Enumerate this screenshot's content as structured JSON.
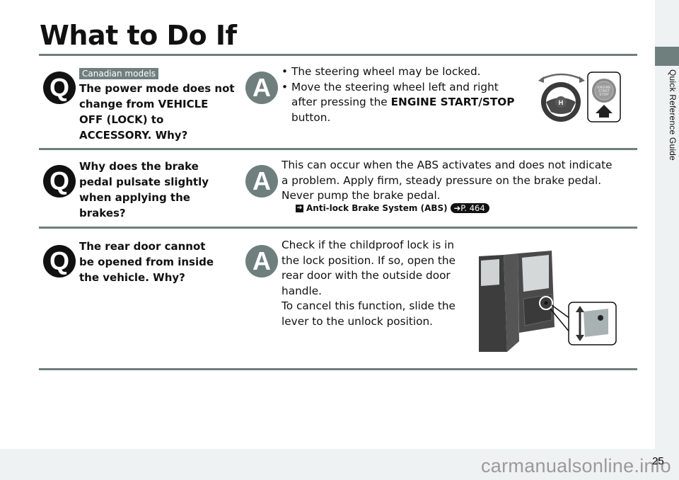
{
  "page": {
    "title": "What to Do If",
    "section_tab": "Quick Reference Guide",
    "page_number": "25",
    "watermark": "carmanualsonline.info"
  },
  "qa": [
    {
      "badge": "Canadian models",
      "question": "The power mode does not change from VEHICLE OFF (LOCK) to ACCESSORY. Why?",
      "answer_bullets": [
        "The steering wheel may be locked.",
        "Move the steering wheel left and right after pressing the"
      ],
      "answer_bold": "ENGINE START/STOP",
      "answer_tail": "button.",
      "illustration": "steering-wheel-and-engine-start-stop-button"
    },
    {
      "question": "Why does the brake pedal pulsate slightly when applying the brakes?",
      "answer": "This can occur when the ABS activates and does not indicate a problem. Apply firm, steady pressure on the brake pedal. Never pump the brake pedal.",
      "reference": {
        "label": "Anti-lock Brake System (ABS)",
        "page": "P. 464"
      }
    },
    {
      "question": "The rear door cannot be opened from inside the vehicle. Why?",
      "answer_lines": [
        "Check if the childproof lock is in the lock position. If so, open the rear door with the outside door handle.",
        "To cancel this function, slide the lever to the unlock position."
      ],
      "illustration": "rear-door-childproof-lock"
    }
  ],
  "icons": {
    "q": "Q",
    "a": "A"
  },
  "colors": {
    "accent": "#6f7f7d",
    "dark": "#111111"
  }
}
